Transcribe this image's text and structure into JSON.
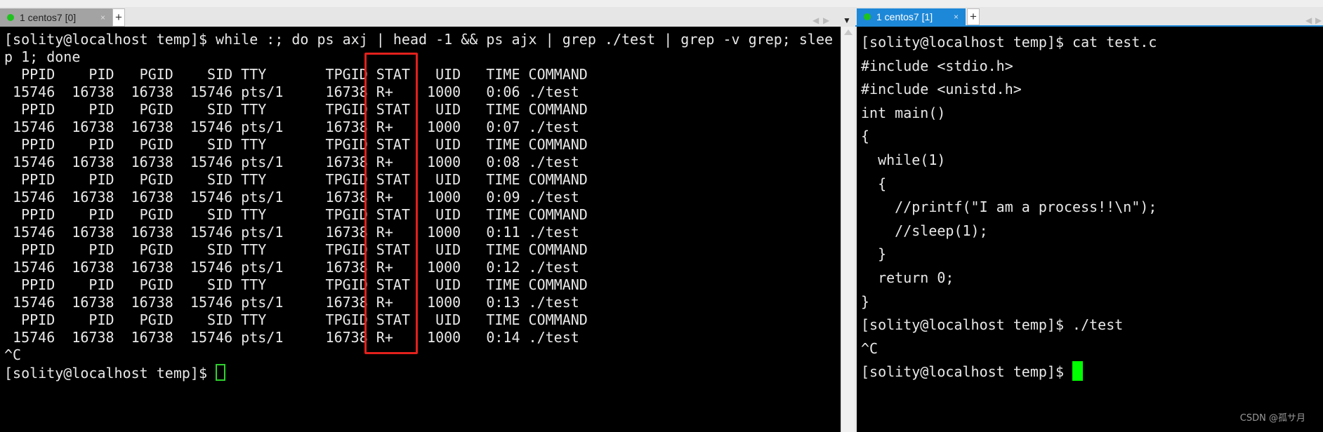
{
  "left_pane": {
    "tab_label": "1 centos7 [0]",
    "tab_close": "×",
    "plus": "+",
    "lines": [
      "[solity@localhost temp]$ while :; do ps axj | head -1 && ps ajx | grep ./test | grep -v grep; slee",
      "p 1; done",
      "  PPID    PID   PGID    SID TTY       TPGID STAT   UID   TIME COMMAND",
      " 15746  16738  16738  15746 pts/1     16738 R+    1000   0:06 ./test",
      "  PPID    PID   PGID    SID TTY       TPGID STAT   UID   TIME COMMAND",
      " 15746  16738  16738  15746 pts/1     16738 R+    1000   0:07 ./test",
      "  PPID    PID   PGID    SID TTY       TPGID STAT   UID   TIME COMMAND",
      " 15746  16738  16738  15746 pts/1     16738 R+    1000   0:08 ./test",
      "  PPID    PID   PGID    SID TTY       TPGID STAT   UID   TIME COMMAND",
      " 15746  16738  16738  15746 pts/1     16738 R+    1000   0:09 ./test",
      "  PPID    PID   PGID    SID TTY       TPGID STAT   UID   TIME COMMAND",
      " 15746  16738  16738  15746 pts/1     16738 R+    1000   0:11 ./test",
      "  PPID    PID   PGID    SID TTY       TPGID STAT   UID   TIME COMMAND",
      " 15746  16738  16738  15746 pts/1     16738 R+    1000   0:12 ./test",
      "  PPID    PID   PGID    SID TTY       TPGID STAT   UID   TIME COMMAND",
      " 15746  16738  16738  15746 pts/1     16738 R+    1000   0:13 ./test",
      "  PPID    PID   PGID    SID TTY       TPGID STAT   UID   TIME COMMAND",
      " 15746  16738  16738  15746 pts/1     16738 R+    1000   0:14 ./test",
      "^C"
    ],
    "prompt": "[solity@localhost temp]$ ",
    "highlight_color": "#e3201c"
  },
  "right_pane": {
    "tab_label": "1 centos7 [1]",
    "tab_close": "×",
    "plus": "+",
    "lines": [
      "[solity@localhost temp]$ cat test.c",
      "#include <stdio.h>",
      "#include <unistd.h>",
      "int main()",
      "{",
      "  while(1)",
      "  {",
      "    //printf(\"I am a process!!\\n\");",
      "    //sleep(1);",
      "  }",
      "  return 0;",
      "}",
      "[solity@localhost temp]$ ./test",
      "^C"
    ],
    "prompt": "[solity@localhost temp]$ ",
    "active_tab_color": "#1e88d8",
    "cursor_color": "#00ff00"
  },
  "watermark": "CSDN @孤サ月"
}
